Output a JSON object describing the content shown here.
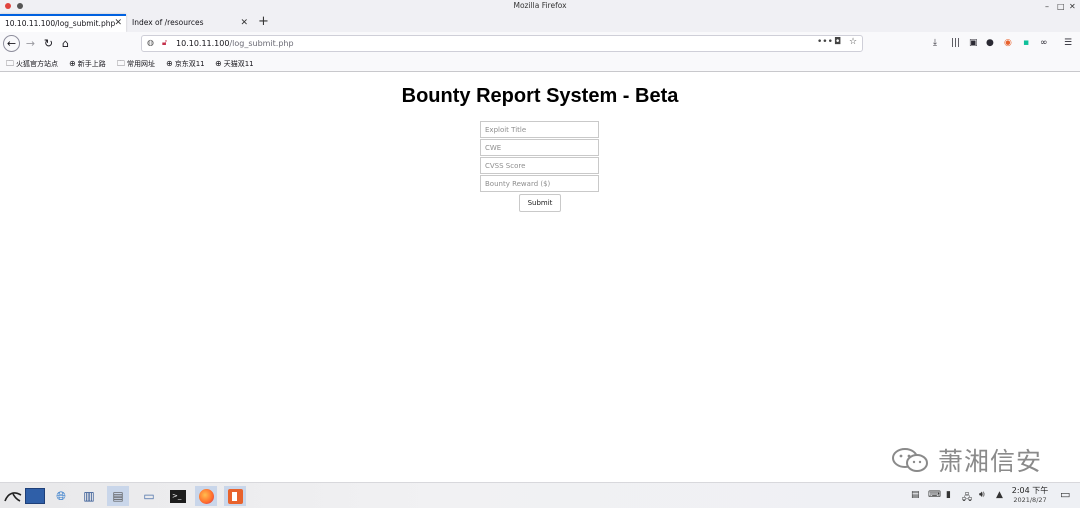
{
  "window": {
    "title": "Mozilla Firefox",
    "traffic_colors": [
      "#e0443e",
      "#7a7a7a"
    ]
  },
  "tabs": [
    {
      "label": "10.10.11.100/log_submit.php",
      "active": true
    },
    {
      "label": "Index of /resources",
      "active": false
    }
  ],
  "navbar": {
    "url_host": "10.10.11.100",
    "url_path": "/log_submit.php"
  },
  "bookmarks": [
    "火狐官方站点",
    "新手上路",
    "常用网址",
    "京东双11",
    "天猫双11"
  ],
  "page": {
    "title": "Bounty Report System - Beta",
    "fields": [
      {
        "placeholder": "Exploit Title"
      },
      {
        "placeholder": "CWE"
      },
      {
        "placeholder": "CVSS Score"
      },
      {
        "placeholder": "Bounty Reward ($)"
      }
    ],
    "submit_label": "Submit"
  },
  "watermark": {
    "text": "萧湘信安"
  },
  "taskbar": {
    "time": "2:04 下午",
    "date": "2021/8/27"
  },
  "colors": {
    "accent": "#0061e0",
    "taskbar_highlight": "#c9d6ea"
  }
}
